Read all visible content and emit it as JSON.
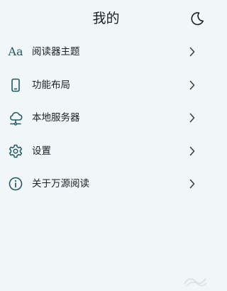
{
  "header": {
    "title": "我的",
    "theme_toggle_icon": "moon-icon"
  },
  "menu": {
    "items": [
      {
        "label": "阅读器主题",
        "icon": "font-aa-icon",
        "icon_text": "Aa"
      },
      {
        "label": "功能布局",
        "icon": "phone-icon"
      },
      {
        "label": "本地服务器",
        "icon": "cloud-network-icon"
      },
      {
        "label": "设置",
        "icon": "gear-icon"
      },
      {
        "label": "关于万源阅读",
        "icon": "info-icon"
      }
    ]
  },
  "colors": {
    "background": "#f1f6f9",
    "icon_accent": "#1f5a63",
    "text": "#1a1f24",
    "chevron": "#3a4248"
  }
}
